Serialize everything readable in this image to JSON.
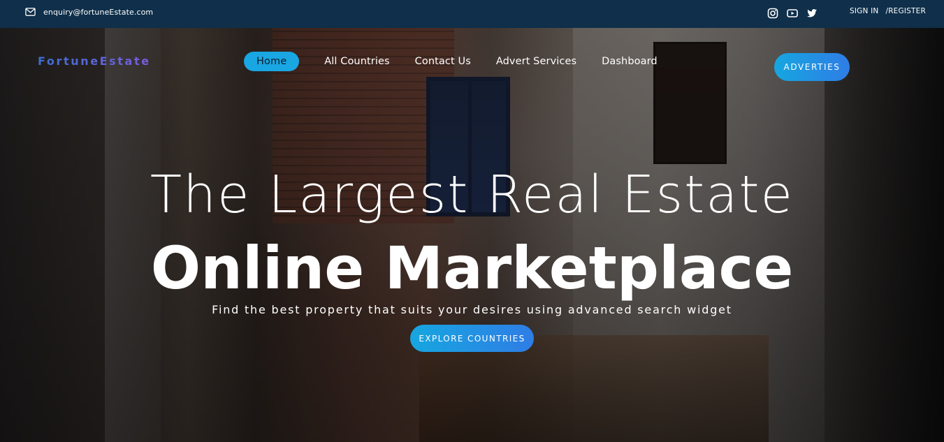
{
  "topbar": {
    "email": "enquiry@fortuneEstate.com",
    "social_icons": [
      "instagram-icon",
      "youtube-icon",
      "twitter-icon"
    ],
    "sign_in": "SIGN IN",
    "register": "/REGISTER"
  },
  "header": {
    "brand": "FortuneEstate",
    "nav": [
      {
        "label": "Home",
        "active": true
      },
      {
        "label": "All Countries",
        "active": false
      },
      {
        "label": "Contact Us",
        "active": false
      },
      {
        "label": "Advert Services",
        "active": false
      },
      {
        "label": "Dashboard",
        "active": false
      }
    ],
    "cta": "ADVERTIES"
  },
  "hero": {
    "title_line1": "The Largest Real Estate",
    "title_line2": "Online Marketplace",
    "subtitle": "Find the best property that suits your desires using advanced search widget",
    "button": "EXPLORE COUNTRIES"
  },
  "colors": {
    "topbar_bg": "#0f2f4a",
    "accent": "#19a6e3",
    "accent_end": "#2f7de5",
    "brand_start": "#3b6fd1",
    "brand_end": "#7a5de0"
  }
}
